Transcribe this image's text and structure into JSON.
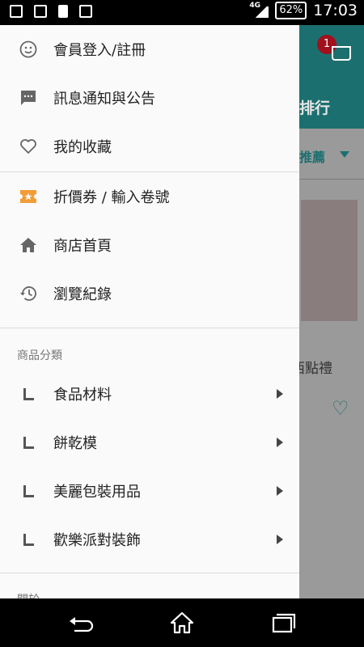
{
  "status_bar": {
    "time": "17:03",
    "battery": "62%",
    "network": "4G",
    "icons": [
      "usb-icon",
      "screen-mirror-icon",
      "phone-icon",
      "image-icon"
    ]
  },
  "background_app": {
    "cart_badge_count": "1",
    "header_partial_title": "排行",
    "recommend_partial_label": "推薦",
    "product_partial_caption": "西點禮"
  },
  "drawer": {
    "top_items": [
      {
        "icon": "smiley-icon",
        "label": "會員登入/註冊"
      },
      {
        "icon": "message-icon",
        "label": "訊息通知與公告"
      },
      {
        "icon": "heart-icon",
        "label": "我的收藏"
      }
    ],
    "mid_items": [
      {
        "icon": "coupon-icon",
        "label": "折價券 / 輸入卷號"
      },
      {
        "icon": "home-icon",
        "label": "商店首頁"
      },
      {
        "icon": "history-icon",
        "label": "瀏覽紀錄"
      }
    ],
    "category_section_title": "商品分類",
    "categories": [
      {
        "label": "食品材料"
      },
      {
        "label": "餅乾模"
      },
      {
        "label": "美麗包裝用品"
      },
      {
        "label": "歡樂派對裝飾"
      }
    ],
    "next_section_partial": "關於"
  },
  "colors": {
    "accent_orange": "#f29d38",
    "icon_gray": "#666666",
    "teal_brand": "#1c6f6f"
  }
}
